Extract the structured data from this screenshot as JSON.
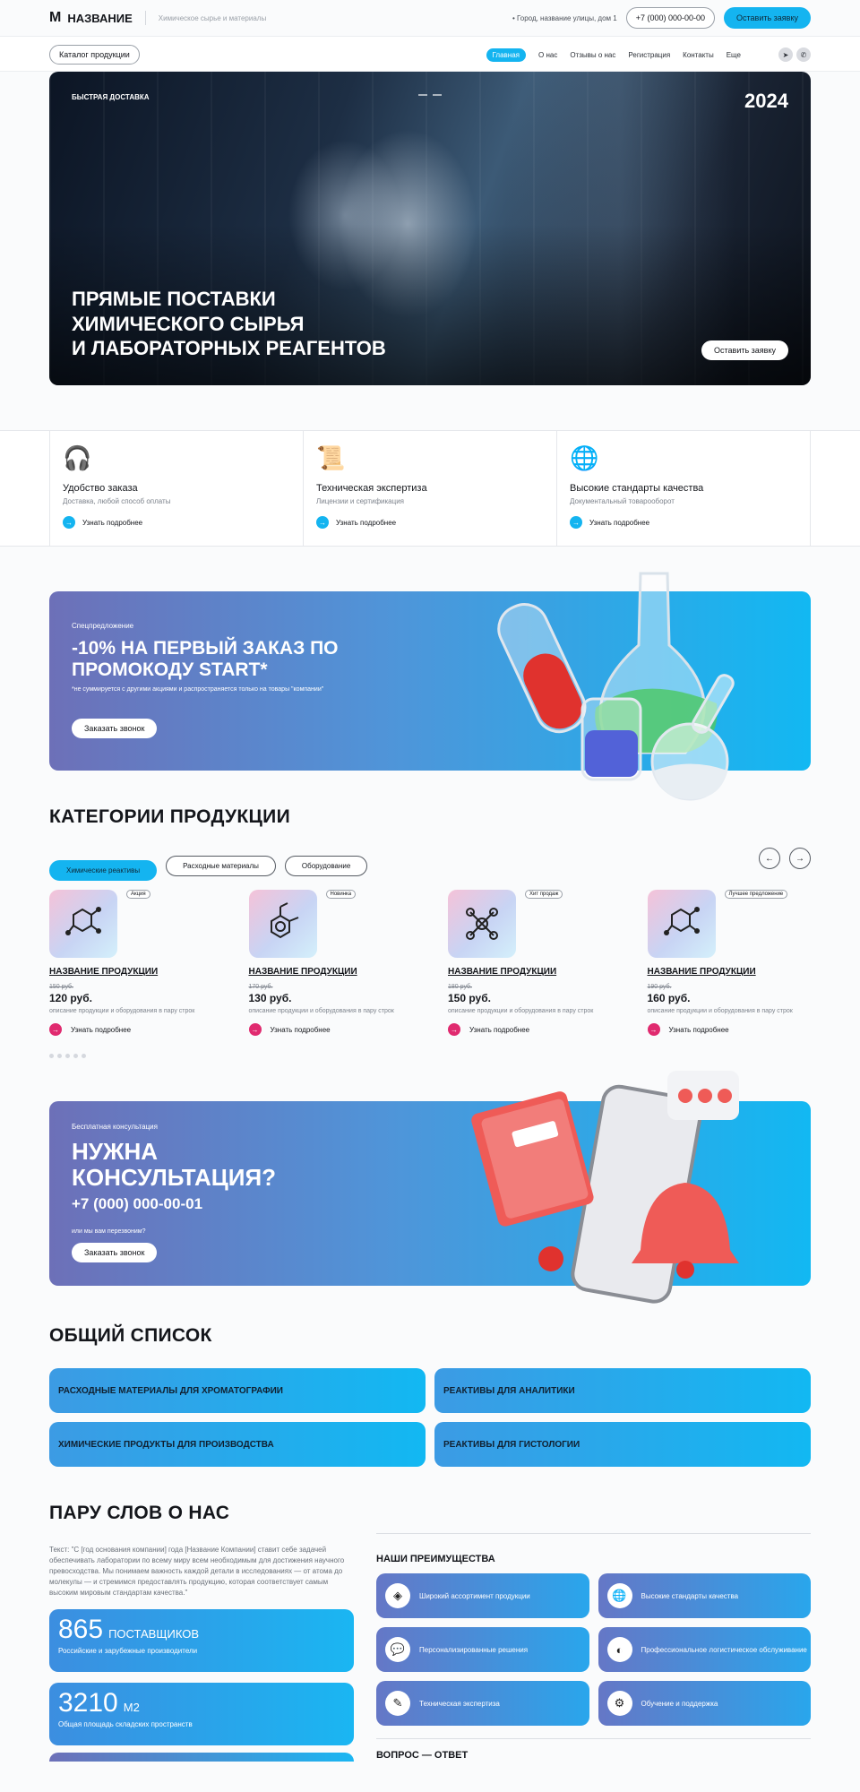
{
  "header": {
    "logo_mark": "M",
    "logo_name": "НАЗВАНИЕ",
    "tagline": "Химическое сырье и материалы",
    "address": "Город, название улицы, дом 1",
    "phone": "+7 (000) 000-00-00",
    "cta": "Оставить заявку"
  },
  "nav": {
    "catalog": "Каталог продукции",
    "links": [
      "Главная",
      "О нас",
      "Отзывы о нас",
      "Регистрация",
      "Контакты",
      "Еще"
    ]
  },
  "hero": {
    "tag": "БЫСТРАЯ ДОСТАВКА",
    "year": "2024",
    "title_lines": [
      "ПРЯМЫЕ ПОСТАВКИ",
      "ХИМИЧЕСКОГО СЫРЬЯ",
      "И ЛАБОРАТОРНЫХ РЕАГЕНТОВ"
    ],
    "button": "Оставить заявку"
  },
  "features": [
    {
      "icon": "headset-icon",
      "title": "Удобство заказа",
      "sub": "Доставка, любой способ оплаты",
      "more": "Узнать подробнее"
    },
    {
      "icon": "certificate-icon",
      "title": "Техническая экспертиза",
      "sub": "Лицензии и сертификация",
      "more": "Узнать подробнее"
    },
    {
      "icon": "globe-icon",
      "title": "Высокие стандарты качества",
      "sub": "Документальный товарооборот",
      "more": "Узнать подробнее"
    }
  ],
  "promo": {
    "tag": "Спецпредложение",
    "title_lines": [
      "-10% НА ПЕРВЫЙ ЗАКАЗ ПО",
      "ПРОМОКОДУ START*"
    ],
    "note": "*не суммируется с другими акциями и распространяется только на товары \"компании\"",
    "button": "Заказать звонок"
  },
  "categories": {
    "title": "КАТЕГОРИИ ПРОДУКЦИИ",
    "tabs": [
      "Химические реактивы",
      "Расходные материалы",
      "Оборудование"
    ],
    "products": [
      {
        "badge": "Акция",
        "name": "НАЗВАНИЕ ПРОДУКЦИИ",
        "old_price": "150 руб.",
        "price": "120 руб.",
        "desc": "описание продукции и оборудования в пару строк",
        "more": "Узнать подробнее"
      },
      {
        "badge": "Новинка",
        "name": "НАЗВАНИЕ ПРОДУКЦИИ",
        "old_price": "170 руб.",
        "price": "130 руб.",
        "desc": "описание продукции и оборудования в пару строк",
        "more": "Узнать подробнее"
      },
      {
        "badge": "Хит продаж",
        "name": "НАЗВАНИЕ ПРОДУКЦИИ",
        "old_price": "180 руб.",
        "price": "150 руб.",
        "desc": "описание продукции и оборудования в пару строк",
        "more": "Узнать подробнее"
      },
      {
        "badge": "Лучшее предложение",
        "name": "НАЗВАНИЕ ПРОДУКЦИИ",
        "old_price": "190 руб.",
        "price": "160 руб.",
        "desc": "описание продукции и оборудования в пару строк",
        "more": "Узнать подробнее"
      }
    ]
  },
  "consult": {
    "tag": "Бесплатная консультация",
    "title_lines": [
      "НУЖНА",
      "КОНСУЛЬТАЦИЯ?"
    ],
    "phone": "+7 (000) 000-00-01",
    "note": "или мы вам перезвоним?",
    "button": "Заказать звонок"
  },
  "general_list": {
    "title": "ОБЩИЙ СПИСОК",
    "items": [
      "РАСХОДНЫЕ МАТЕРИАЛЫ ДЛЯ ХРОМАТОГРАФИИ",
      "РЕАКТИВЫ ДЛЯ АНАЛИТИКИ",
      "ХИМИЧЕСКИЕ ПРОДУКТЫ ДЛЯ ПРОИЗВОДСТВА",
      "РЕАКТИВЫ ДЛЯ ГИСТОЛОГИИ"
    ]
  },
  "about": {
    "title": "ПАРУ СЛОВ О НАС",
    "text": "Текст: \"С [год основания компании] года [Название Компании] ставит себе задачей обеспечивать лаборатории по всему миру всем необходимым для достижения научного превосходства. Мы понимаем важность каждой детали в исследованиях — от атома до молекулы — и стремимся предоставлять продукцию, которая соответствует самым высоким мировым стандартам качества.\"",
    "stats": [
      {
        "num": "865",
        "unit": "ПОСТАВЩИКОВ",
        "desc": "Российские и зарубежные производители"
      },
      {
        "num": "3210",
        "unit": "М2",
        "desc": "Общая площадь складских пространств"
      }
    ],
    "adv_title": "НАШИ ПРЕИМУЩЕСТВА",
    "advantages": [
      {
        "icon": "layers-icon",
        "label": "Широкий ассортимент продукции"
      },
      {
        "icon": "globe-icon",
        "label": "Высокие стандарты качества"
      },
      {
        "icon": "chat-icon",
        "label": "Персонализированные решения"
      },
      {
        "icon": "planet-icon",
        "label": "Профессиональное логистическое обслуживание"
      },
      {
        "icon": "document-icon",
        "label": "Техническая экспертиза"
      },
      {
        "icon": "gear-icon",
        "label": "Обучение и поддержка"
      }
    ],
    "faq_title": "ВОПРОС — ОТВЕТ"
  }
}
